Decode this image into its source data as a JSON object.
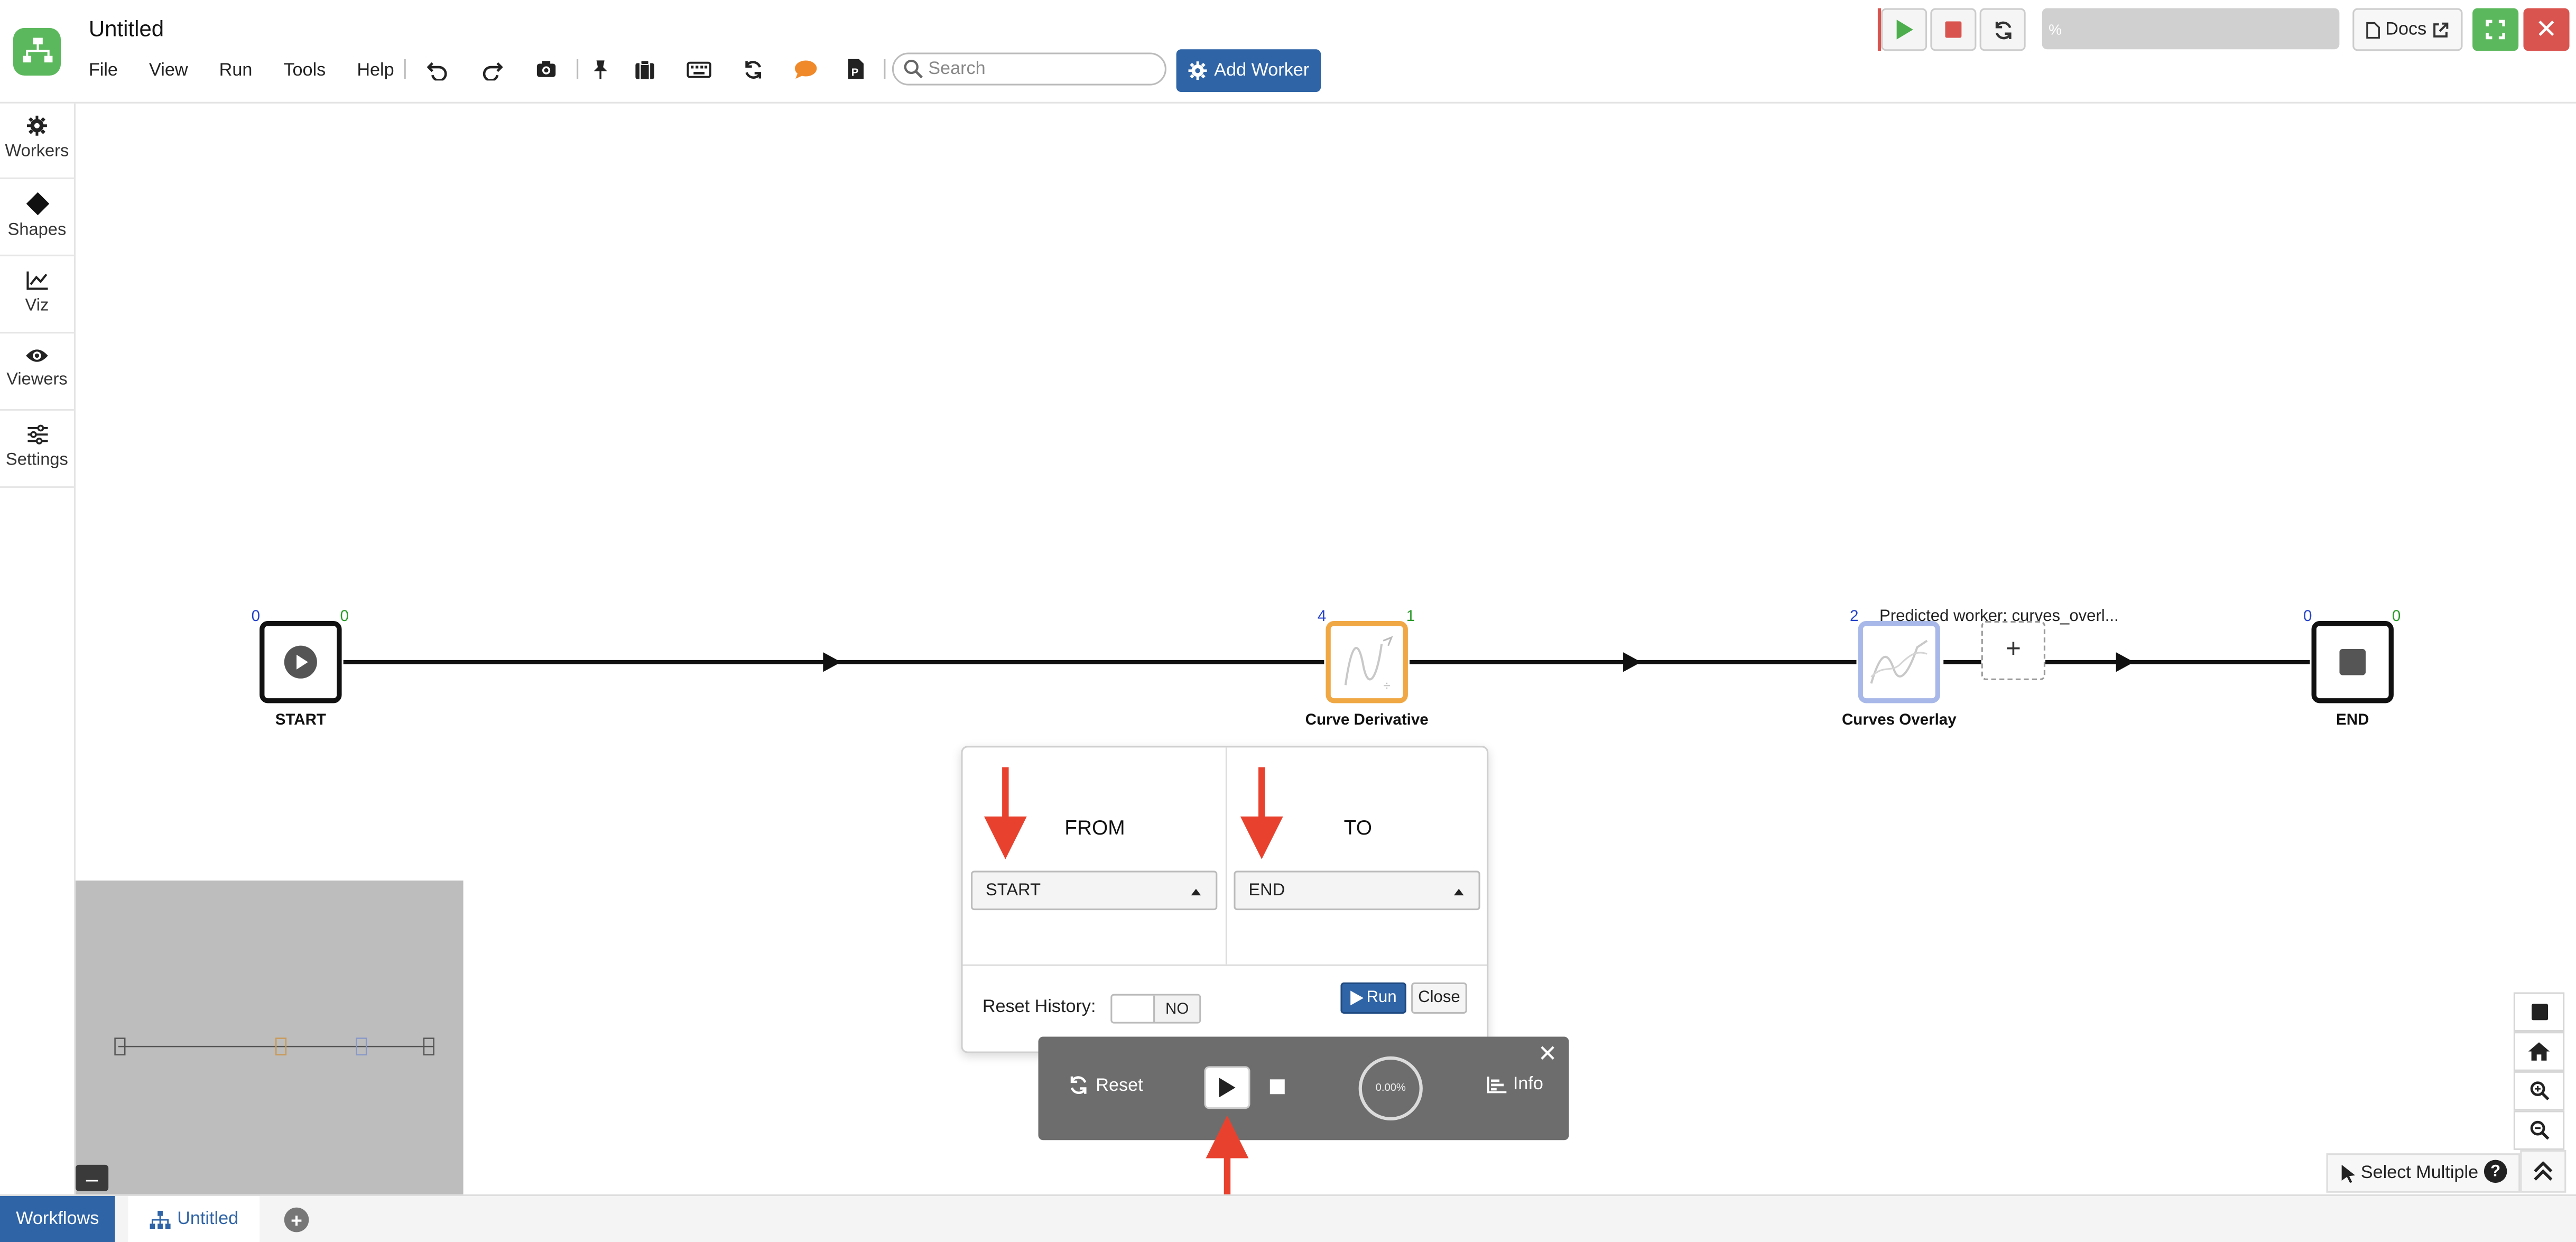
{
  "app": {
    "title": "Untitled"
  },
  "menu": {
    "items": [
      {
        "label": "File"
      },
      {
        "label": "View"
      },
      {
        "label": "Run"
      },
      {
        "label": "Tools"
      },
      {
        "label": "Help"
      }
    ]
  },
  "toolbar": {
    "search_placeholder": "Search",
    "add_worker_label": "Add Worker"
  },
  "topright": {
    "progress_text": "%",
    "docs_label": "Docs",
    "close_symbol": "✕"
  },
  "sidebar": {
    "items": [
      {
        "label": "Workers",
        "icon": "gear-icon"
      },
      {
        "label": "Shapes",
        "icon": "diamond-icon"
      },
      {
        "label": "Viz",
        "icon": "line-chart-icon"
      },
      {
        "label": "Viewers",
        "icon": "eye-icon"
      },
      {
        "label": "Settings",
        "icon": "sliders-icon"
      }
    ]
  },
  "nodes": [
    {
      "label": "START",
      "in": "0",
      "out": "0"
    },
    {
      "label": "Curve Derivative",
      "in": "4",
      "out": "1"
    },
    {
      "label": "Curves Overlay",
      "in": "2",
      "out": ""
    },
    {
      "label": "END",
      "in": "0",
      "out": "0"
    }
  ],
  "predicted_worker": "Predicted worker: curves_overl...",
  "run_dialog": {
    "from_title": "FROM",
    "to_title": "TO",
    "from_value": "START",
    "to_value": "END",
    "reset_history_label": "Reset History:",
    "reset_history_value": "NO",
    "run_label": "Run",
    "close_label": "Close"
  },
  "run_panel": {
    "reset_label": "Reset",
    "progress": "0.00%",
    "info_label": "Info"
  },
  "bottom": {
    "select_multiple_label": "Select Multiple",
    "help_symbol": "?",
    "workflows_tab": "Workflows",
    "untitled_tab": "Untitled",
    "add_tab_symbol": "+"
  },
  "colors": {
    "accent": "#2f64a6",
    "success": "#5cb85c",
    "danger": "#d9534f",
    "annotation_arrow": "#e8422f",
    "node_orange": "#f0a845",
    "node_blue": "#a8b8e8"
  }
}
